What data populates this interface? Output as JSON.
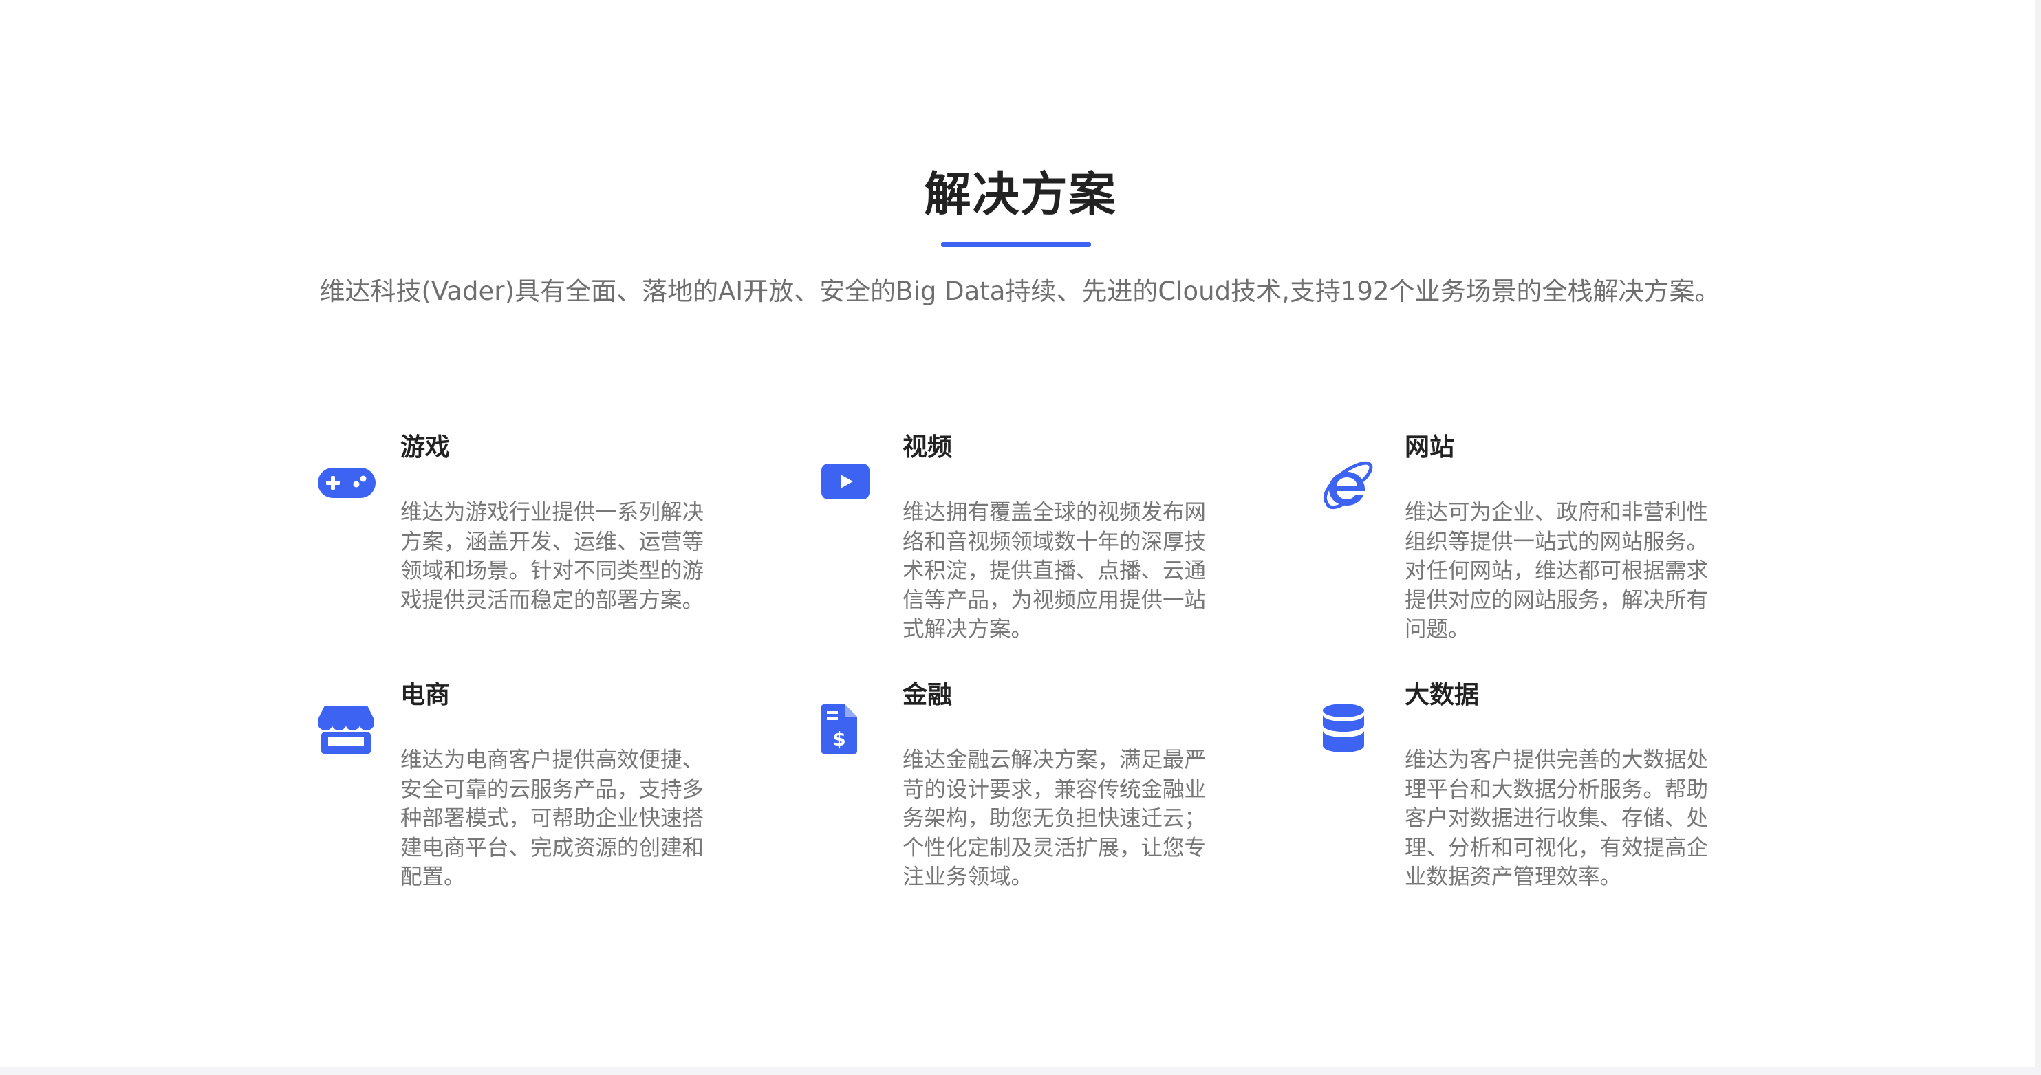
{
  "header": {
    "title": "解决方案",
    "description": "维达科技(Vader)具有全面、落地的AI开放、安全的Big Data持续、先进的Cloud技术,支持192个业务场景的全栈解决方案。"
  },
  "colors": {
    "accent": "#3c63f2",
    "title_text": "#222222",
    "body_text": "#777777"
  },
  "solutions": [
    {
      "icon": "gamepad-icon",
      "title": "游戏",
      "description": "维达为游戏行业提供一系列解决方案，涵盖开发、运维、运营等领域和场景。针对不同类型的游戏提供灵活而稳定的部署方案。"
    },
    {
      "icon": "video-play-icon",
      "title": "视频",
      "description": "维达拥有覆盖全球的视频发布网络和音视频领域数十年的深厚技术积淀，提供直播、点播、云通信等产品，为视频应用提供一站式解决方案。"
    },
    {
      "icon": "internet-explorer-icon",
      "title": "网站",
      "description": "维达可为企业、政府和非营利性组织等提供一站式的网站服务。对任何网站，维达都可根据需求提供对应的网站服务，解决所有问题。"
    },
    {
      "icon": "storefront-icon",
      "title": "电商",
      "description": "维达为电商客户提供高效便捷、安全可靠的云服务产品，支持多种部署模式，可帮助企业快速搭建电商平台、完成资源的创建和配置。"
    },
    {
      "icon": "invoice-dollar-icon",
      "title": "金融",
      "description": "维达金融云解决方案，满足最严苛的设计要求，兼容传统金融业务架构，助您无负担快速迁云；个性化定制及灵活扩展，让您专注业务领域。"
    },
    {
      "icon": "database-icon",
      "title": "大数据",
      "description": "维达为客户提供完善的大数据处理平台和大数据分析服务。帮助客户对数据进行收集、存储、处理、分析和可视化，有效提高企业数据资产管理效率。"
    }
  ]
}
